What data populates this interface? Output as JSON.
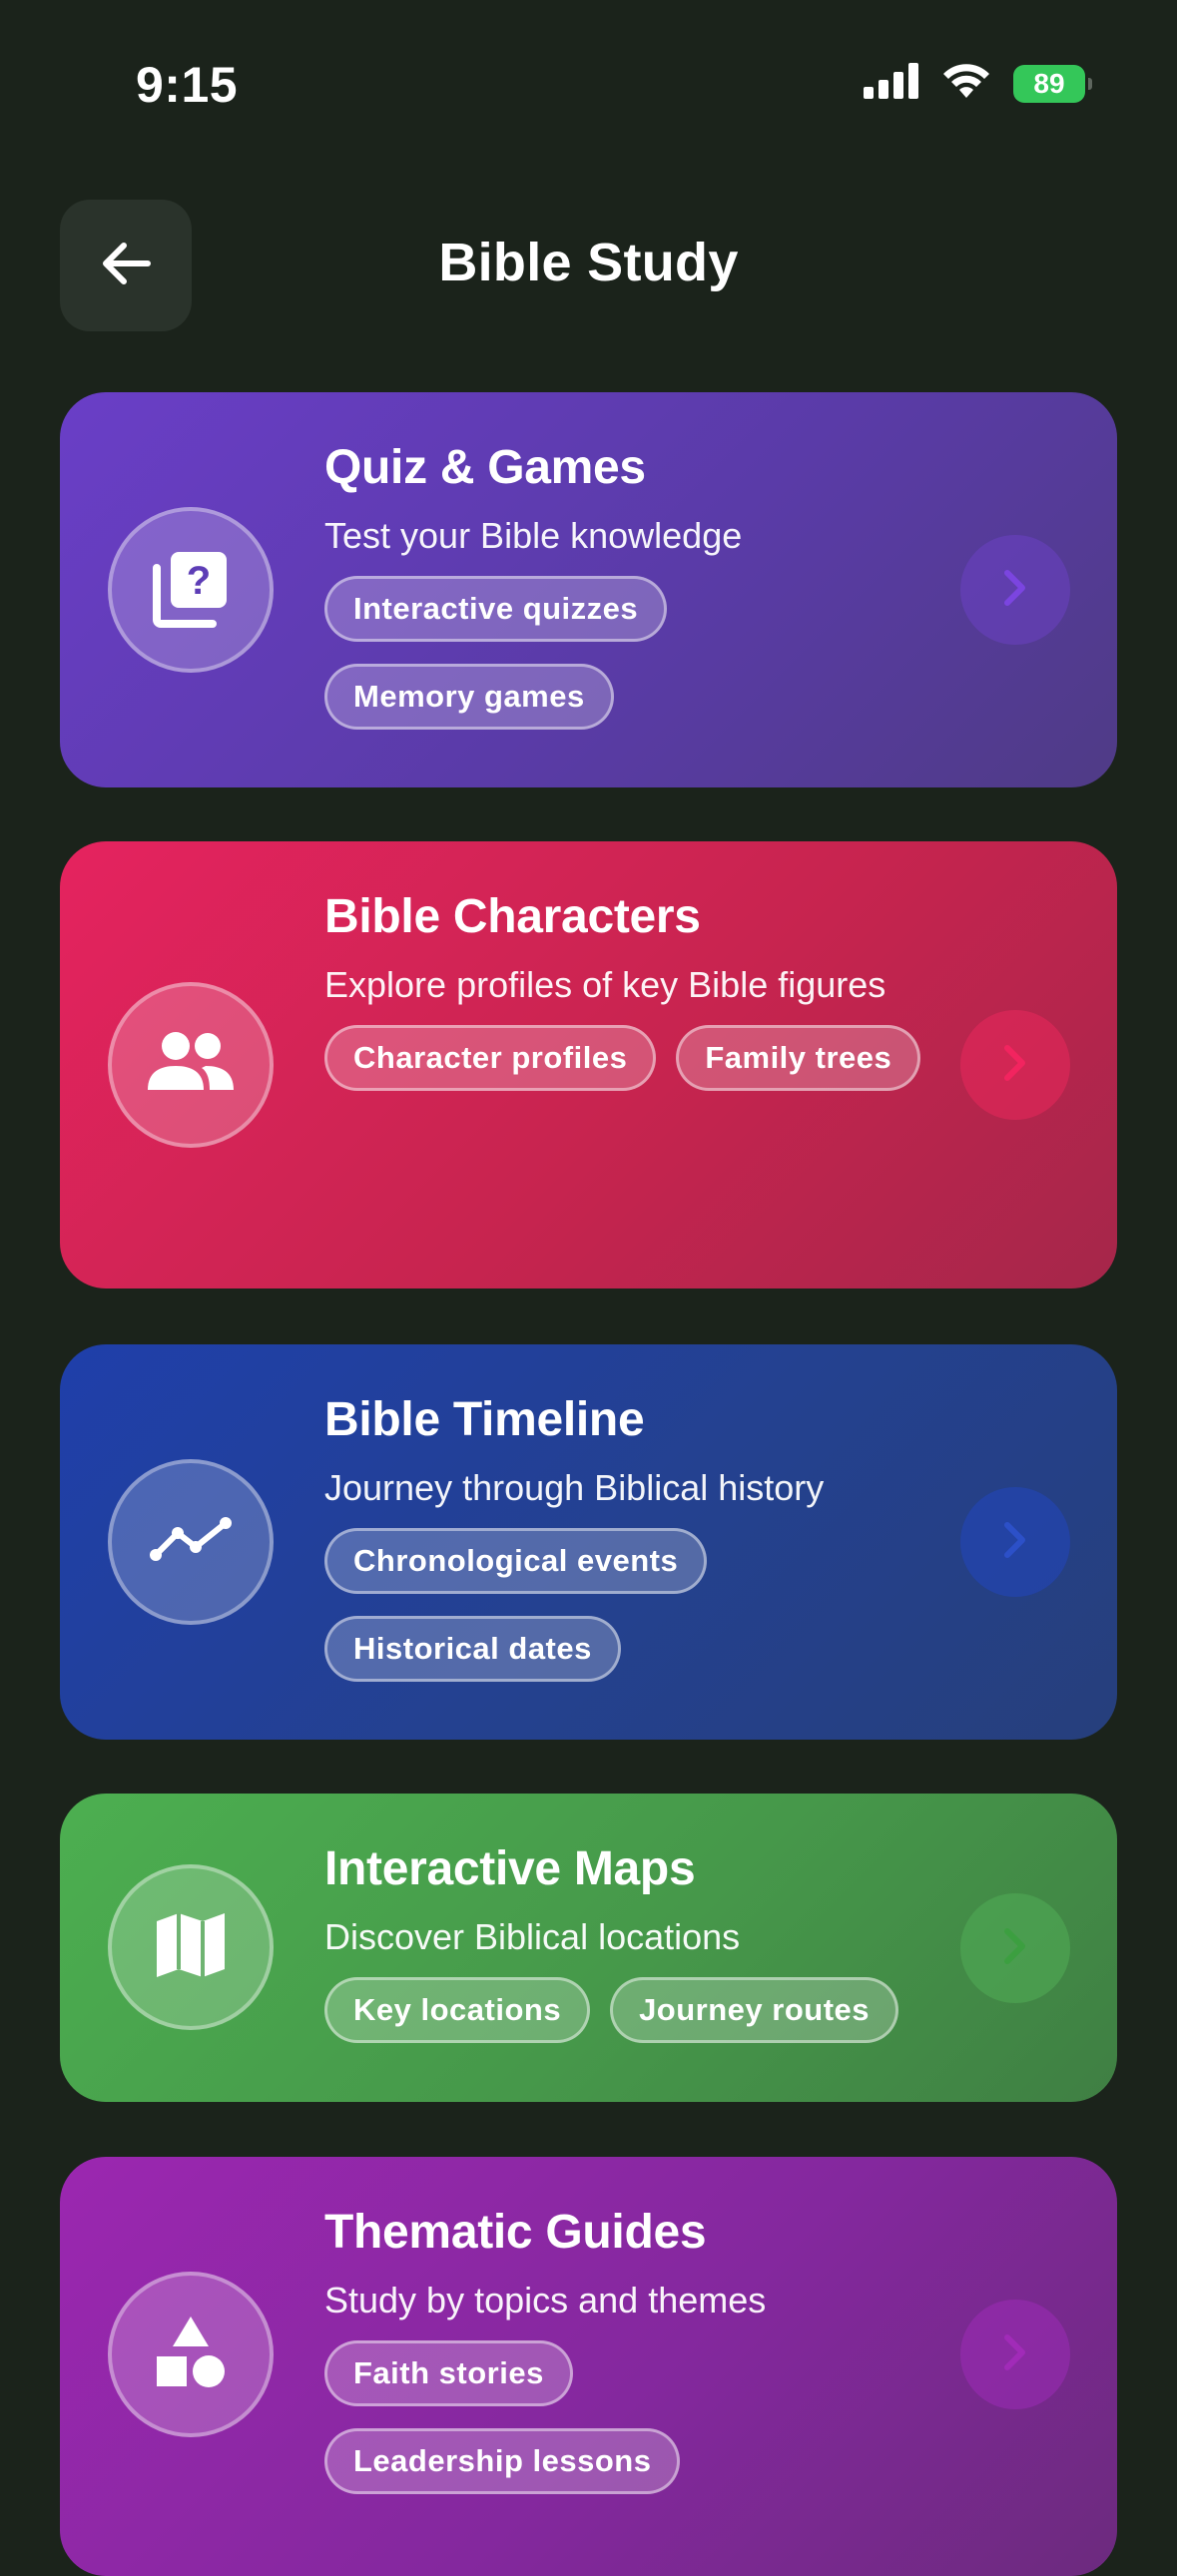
{
  "status_bar": {
    "time": "9:15",
    "battery": "89",
    "icons": [
      "cellular-signal-icon",
      "wifi-icon",
      "battery-icon"
    ]
  },
  "header": {
    "back_icon": "arrow-left-icon",
    "title": "Bible Study"
  },
  "cards": [
    {
      "title": "Quiz & Games",
      "description": "Test your Bible knowledge",
      "icon": "quiz-question-icon",
      "tags": [
        "Interactive quizzes",
        "Memory games"
      ],
      "accent": "#6a3ec7",
      "chevron_color": "#6a3ec7"
    },
    {
      "title": "Bible Characters",
      "description": "Explore profiles of key Bible figures",
      "icon": "people-icon",
      "tags": [
        "Character profiles",
        "Family trees"
      ],
      "accent": "#e5235f",
      "chevron_color": "#e5235f"
    },
    {
      "title": "Bible Timeline",
      "description": "Journey through Biblical history",
      "icon": "timeline-trend-icon",
      "tags": [
        "Chronological events",
        "Historical dates"
      ],
      "accent": "#1f3faa",
      "chevron_color": "#2b4fc4"
    },
    {
      "title": "Interactive Maps",
      "description": "Discover Biblical locations",
      "icon": "map-icon",
      "tags": [
        "Key locations",
        "Journey routes"
      ],
      "accent": "#4caf50",
      "chevron_color": "#3e9e42"
    },
    {
      "title": "Thematic Guides",
      "description": "Study by topics and themes",
      "icon": "shapes-icon",
      "tags": [
        "Faith stories",
        "Leadership lessons"
      ],
      "accent": "#9b27b0",
      "chevron_color": "#a12bb8"
    }
  ]
}
